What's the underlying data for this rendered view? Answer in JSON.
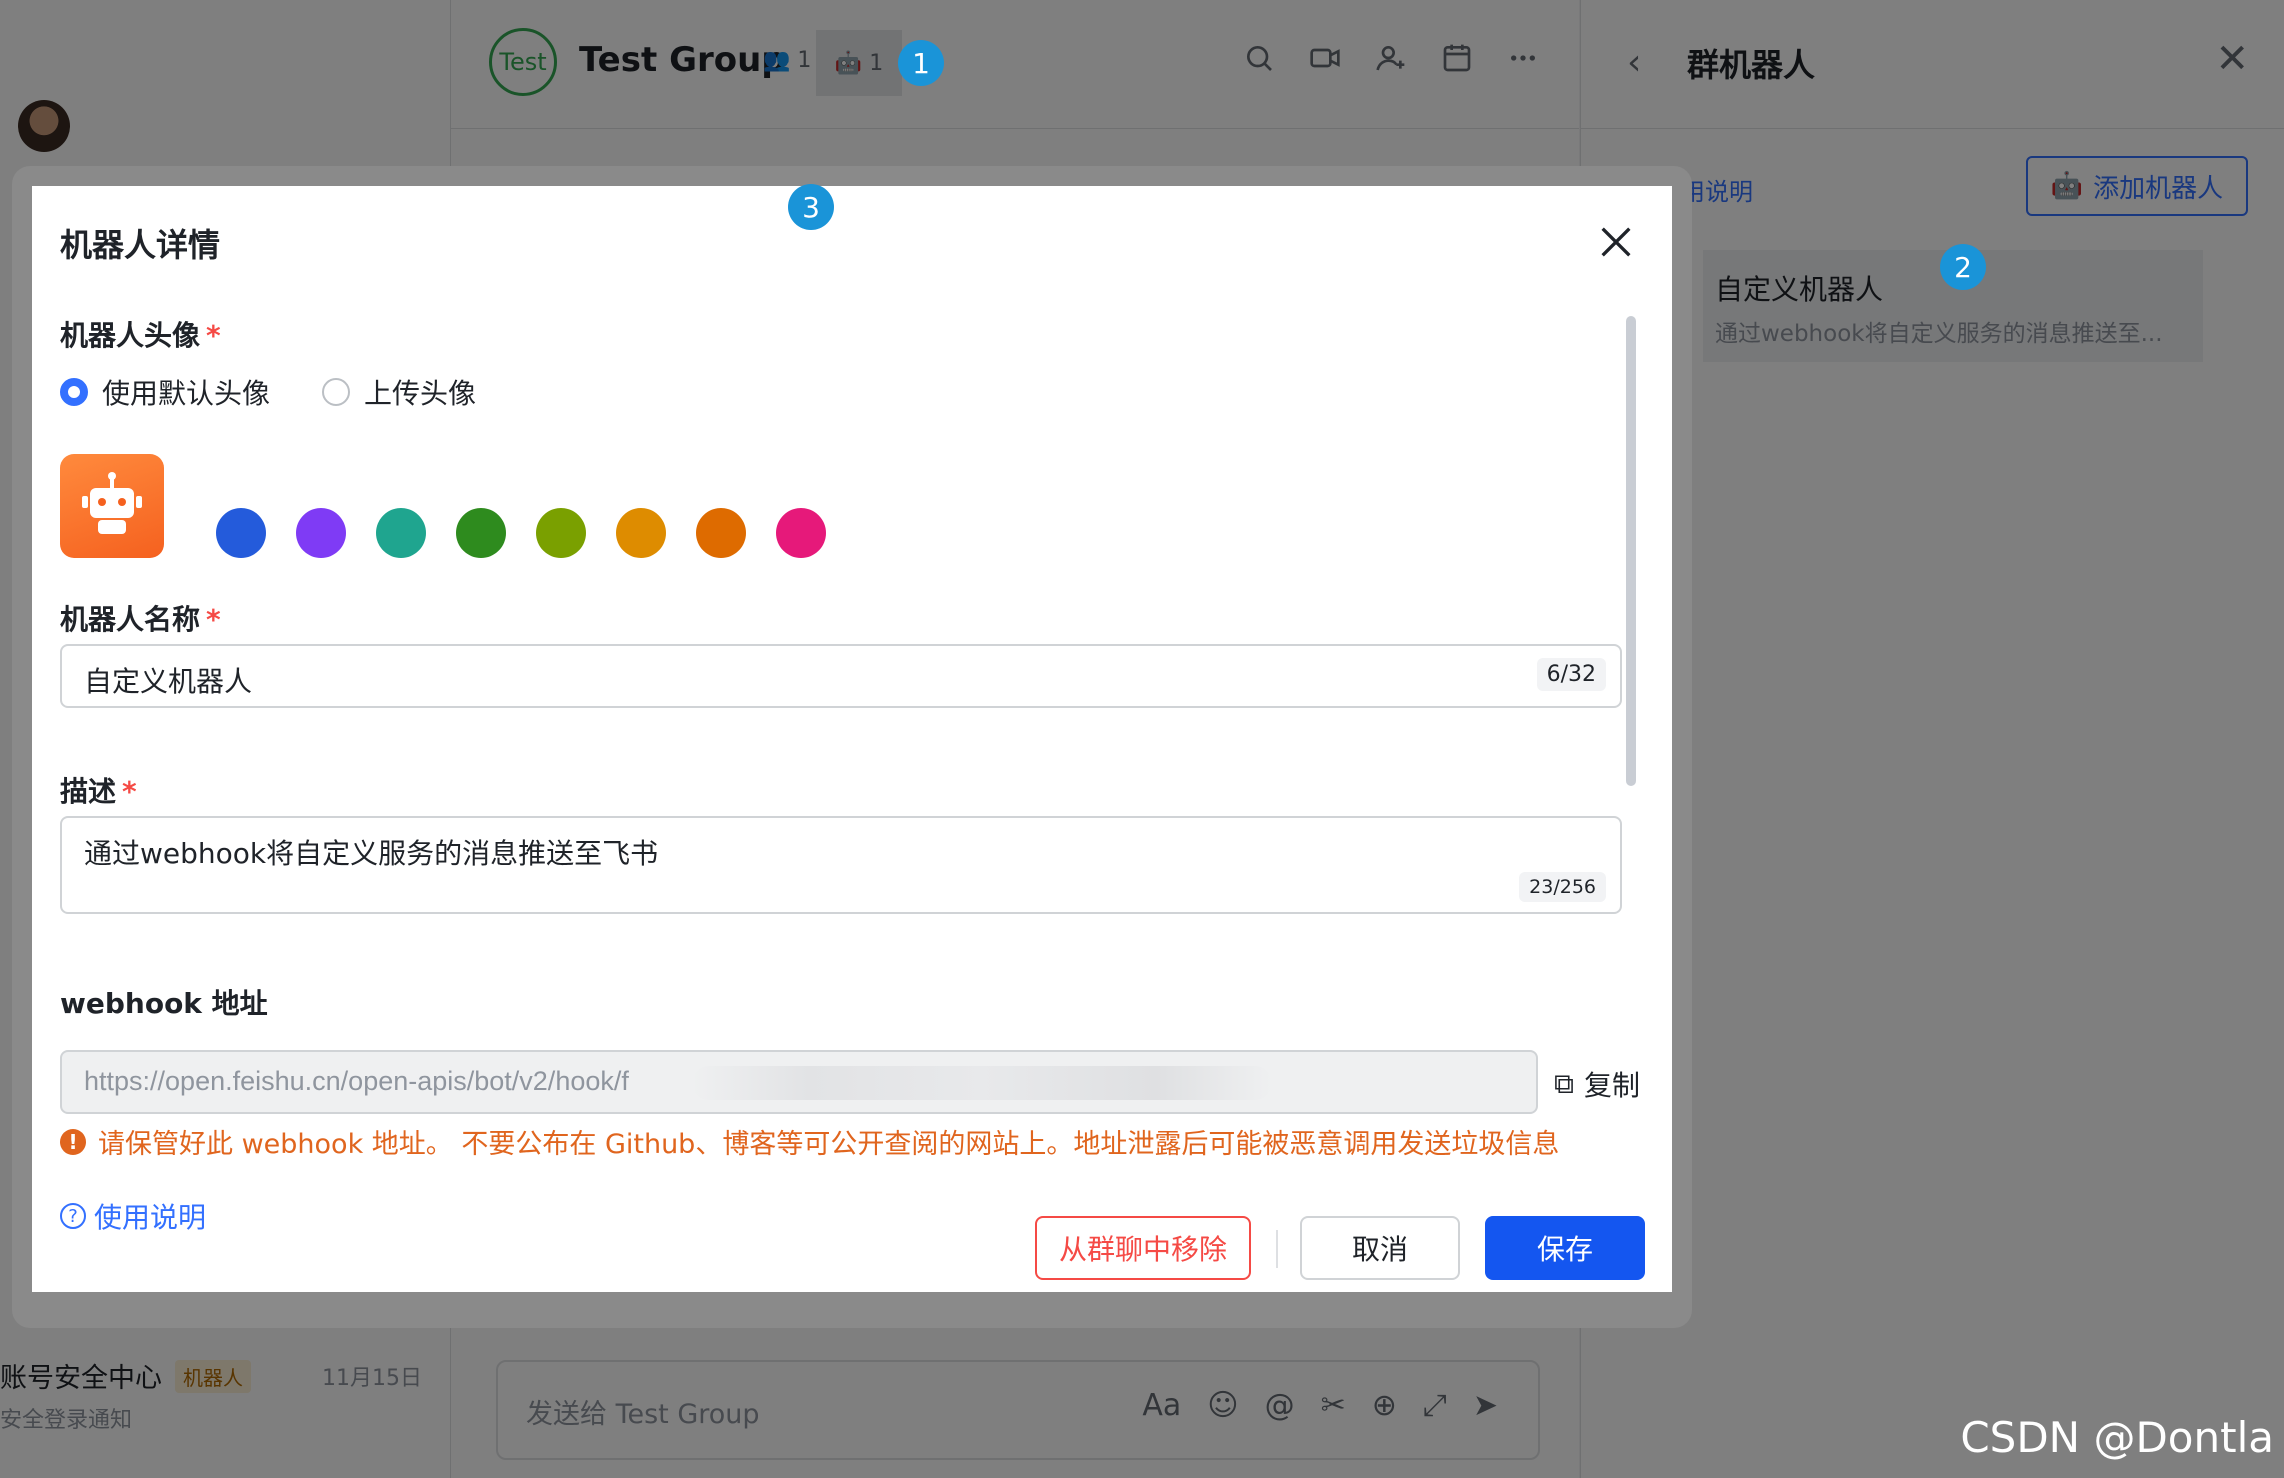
{
  "chat": {
    "group_avatar_text": "Test",
    "group_name": "Test Group",
    "member_count": "1",
    "bot_count": "1",
    "input_placeholder": "发送给 Test Group"
  },
  "left_list": {
    "item_title": "账号安全中心",
    "item_badge": "机器人",
    "item_date": "11月15日",
    "item_subtitle": "安全登录通知"
  },
  "bot_panel": {
    "title": "群机器人",
    "usage_link": "用说明",
    "add_button": "添加机器人",
    "card_name": "自定义机器人",
    "card_desc": "通过webhook将自定义服务的消息推送至..."
  },
  "dialog": {
    "title": "机器人详情",
    "avatar_label": "机器人头像",
    "required_mark": "*",
    "radio_default": "使用默认头像",
    "radio_upload": "上传头像",
    "swatch_colors": [
      "#245bdb",
      "#7f3bf5",
      "#1fa58f",
      "#2e8b1e",
      "#7aa000",
      "#de8c00",
      "#de6b00",
      "#e6197a"
    ],
    "robot_color": "#f5611f",
    "name_label": "机器人名称",
    "name_value": "自定义机器人",
    "name_count": "6/32",
    "desc_label": "描述",
    "desc_value": "通过webhook将自定义服务的消息推送至飞书",
    "desc_count": "23/256",
    "webhook_label": "webhook 地址",
    "webhook_value": "https://open.feishu.cn/open-apis/bot/v2/hook/f",
    "copy_label": "复制",
    "warning": "请保管好此 webhook 地址。 不要公布在 Github、博客等可公开查阅的网站上。地址泄露后可能被恶意调用发送垃圾信息",
    "help_link": "使用说明",
    "remove_button": "从群聊中移除",
    "cancel_button": "取消",
    "save_button": "保存"
  },
  "markers": [
    "1",
    "2",
    "3"
  ],
  "watermark": "CSDN @Dontla"
}
